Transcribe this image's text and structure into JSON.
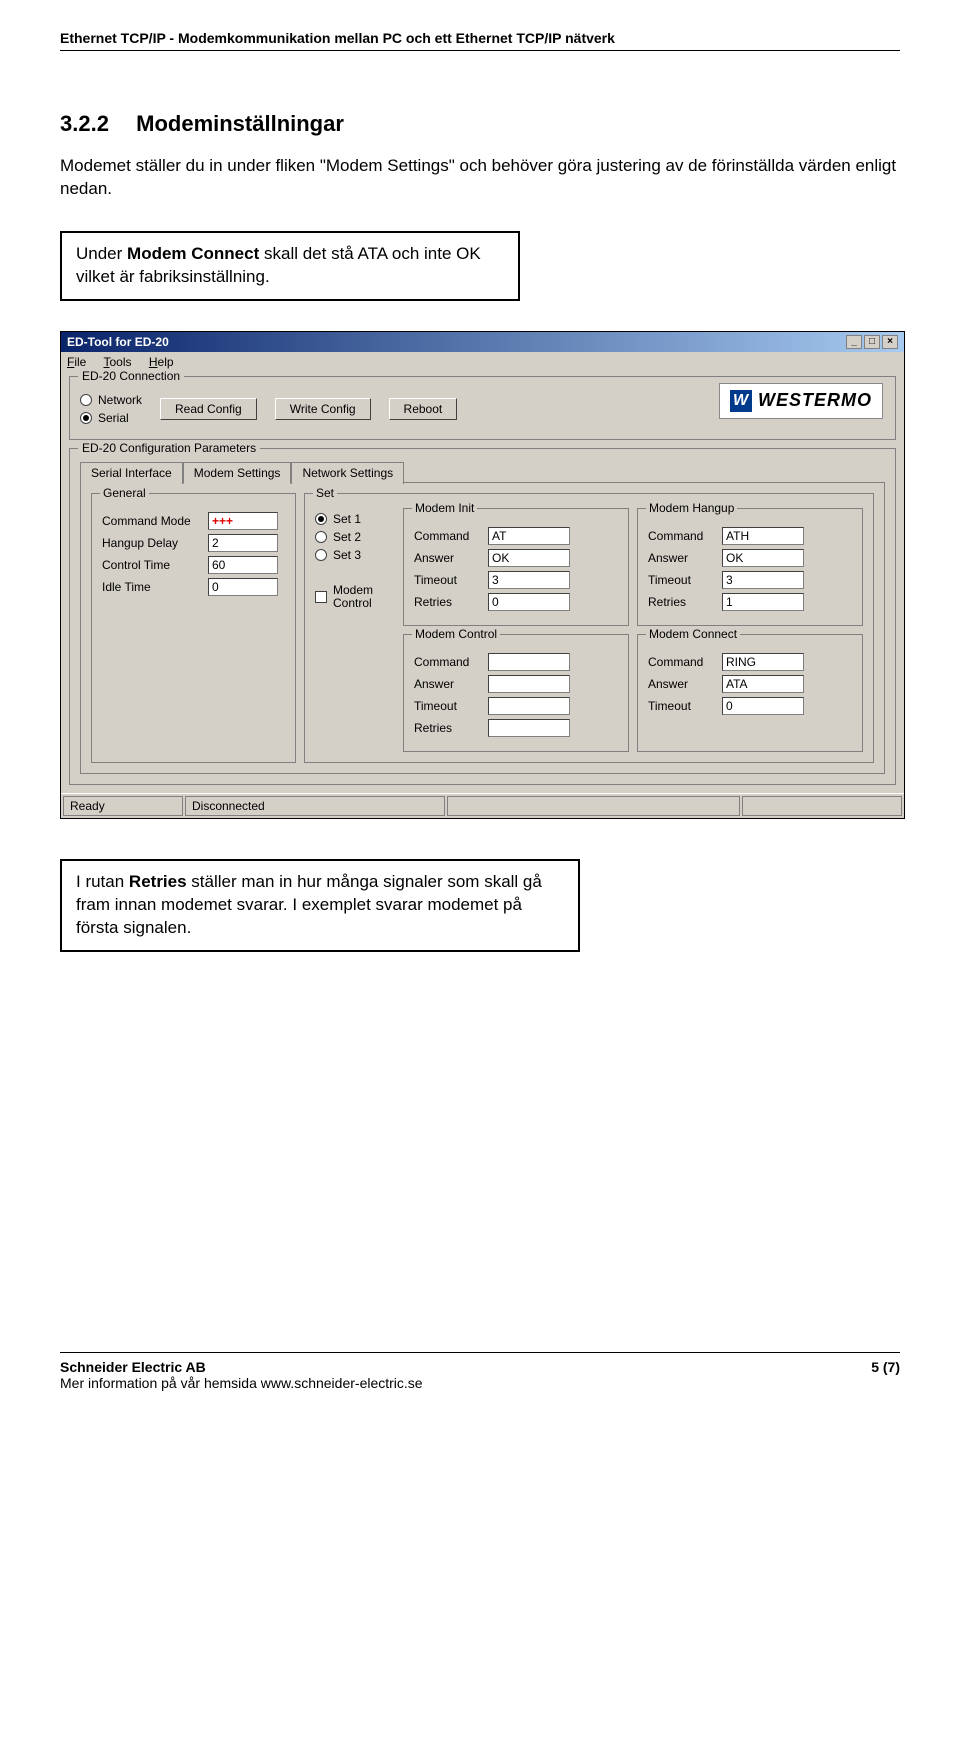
{
  "doc_header": "Ethernet TCP/IP - Modemkommunikation mellan PC och ett Ethernet TCP/IP nätverk",
  "section": {
    "num": "3.2.2",
    "title": "Modeminställningar"
  },
  "intro": "Modemet ställer du in under fliken \"Modem Settings\" och behöver göra justering av de förinställda värden enligt nedan.",
  "callout_upper_prefix": "Under ",
  "callout_upper_bold": "Modem Connect",
  "callout_upper_tail": " skall det stå ATA och inte OK vilket är fabriksinställning.",
  "callout_lower_prefix": "I rutan ",
  "callout_lower_bold": "Retries",
  "callout_lower_tail": " ställer man in hur många signaler som skall gå fram innan modemet svarar. I exemplet svarar modemet på första signalen.",
  "window": {
    "title": "ED-Tool for ED-20",
    "menu": {
      "file": "File",
      "tools": "Tools",
      "help": "Help"
    },
    "win_buttons": {
      "min": "_",
      "max": "□",
      "close": "×"
    },
    "conn_box": {
      "legend": "ED-20 Connection",
      "network": "Network",
      "serial": "Serial",
      "read": "Read Config",
      "write": "Write Config",
      "reboot": "Reboot"
    },
    "logo_text": "WESTERMO",
    "params_legend": "ED-20 Configuration Parameters",
    "tabs": {
      "serial": "Serial Interface",
      "modem": "Modem Settings",
      "network": "Network Settings"
    },
    "general": {
      "legend": "General",
      "command_mode_lbl": "Command Mode",
      "command_mode_val": "+++",
      "hangup_lbl": "Hangup Delay",
      "hangup_val": "2",
      "control_lbl": "Control Time",
      "control_val": "60",
      "idle_lbl": "Idle Time",
      "idle_val": "0"
    },
    "set": {
      "legend": "Set",
      "set1": "Set 1",
      "set2": "Set 2",
      "set3": "Set 3",
      "modem_control_chk": "Modem Control",
      "init": {
        "legend": "Modem Init",
        "command_lbl": "Command",
        "command_val": "AT",
        "answer_lbl": "Answer",
        "answer_val": "OK",
        "timeout_lbl": "Timeout",
        "timeout_val": "3",
        "retries_lbl": "Retries",
        "retries_val": "0"
      },
      "hangup": {
        "legend": "Modem Hangup",
        "command_val": "ATH",
        "answer_val": "OK",
        "timeout_val": "3",
        "retries_val": "1"
      },
      "control": {
        "legend": "Modem Control",
        "command_lbl": "Command",
        "answer_lbl": "Answer",
        "timeout_lbl": "Timeout",
        "retries_lbl": "Retries"
      },
      "connect": {
        "legend": "Modem Connect",
        "command_val": "RING",
        "answer_val": "ATA",
        "timeout_val": "0"
      }
    },
    "status": {
      "ready": "Ready",
      "disc": "Disconnected"
    }
  },
  "footer": {
    "company": "Schneider Electric AB",
    "info": "Mer information på vår hemsida www.schneider-electric.se",
    "page": "5 (7)"
  }
}
